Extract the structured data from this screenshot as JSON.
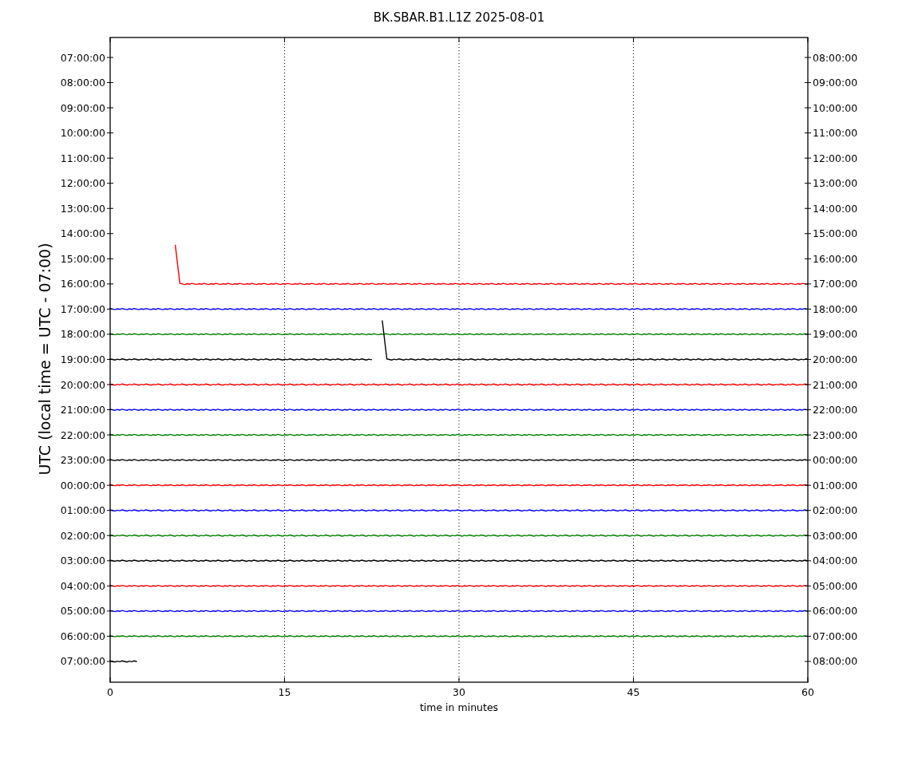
{
  "title": "BK.SBAR.B1.L1Z 2025-08-01",
  "ylabel": "UTC (local time = UTC - 07:00)",
  "xlabel": "time in minutes",
  "x_ticks": [
    "0",
    "15",
    "30",
    "45",
    "60"
  ],
  "y_ticks_left": [
    "07:00:00",
    "08:00:00",
    "09:00:00",
    "10:00:00",
    "11:00:00",
    "12:00:00",
    "13:00:00",
    "14:00:00",
    "15:00:00",
    "16:00:00",
    "17:00:00",
    "18:00:00",
    "19:00:00",
    "20:00:00",
    "21:00:00",
    "22:00:00",
    "23:00:00",
    "00:00:00",
    "01:00:00",
    "02:00:00",
    "03:00:00",
    "04:00:00",
    "05:00:00",
    "06:00:00",
    "07:00:00"
  ],
  "y_ticks_right": [
    "08:00:00",
    "09:00:00",
    "10:00:00",
    "11:00:00",
    "12:00:00",
    "13:00:00",
    "14:00:00",
    "15:00:00",
    "16:00:00",
    "17:00:00",
    "18:00:00",
    "19:00:00",
    "20:00:00",
    "21:00:00",
    "22:00:00",
    "23:00:00",
    "00:00:00",
    "01:00:00",
    "02:00:00",
    "03:00:00",
    "04:00:00",
    "05:00:00",
    "06:00:00",
    "07:00:00",
    "08:00:00"
  ],
  "traces": [
    {
      "kind": "none"
    },
    {
      "kind": "none"
    },
    {
      "kind": "none"
    },
    {
      "kind": "none"
    },
    {
      "kind": "none"
    },
    {
      "kind": "none"
    },
    {
      "kind": "none"
    },
    {
      "kind": "none"
    },
    {
      "kind": "none"
    },
    {
      "kind": "late-start",
      "color": "#ff0000"
    },
    {
      "kind": "flat",
      "color": "#0000ff"
    },
    {
      "kind": "flat",
      "color": "#008000"
    },
    {
      "kind": "gap",
      "color": "#000000"
    },
    {
      "kind": "flat",
      "color": "#ff0000"
    },
    {
      "kind": "flat",
      "color": "#0000ff"
    },
    {
      "kind": "flat",
      "color": "#008000"
    },
    {
      "kind": "flat",
      "color": "#000000"
    },
    {
      "kind": "flat",
      "color": "#ff0000"
    },
    {
      "kind": "flat",
      "color": "#0000ff"
    },
    {
      "kind": "flat",
      "color": "#008000"
    },
    {
      "kind": "flat",
      "color": "#000000"
    },
    {
      "kind": "flat",
      "color": "#ff0000"
    },
    {
      "kind": "flat",
      "color": "#0000ff"
    },
    {
      "kind": "flat",
      "color": "#008000"
    },
    {
      "kind": "short",
      "color": "#000000"
    }
  ]
}
